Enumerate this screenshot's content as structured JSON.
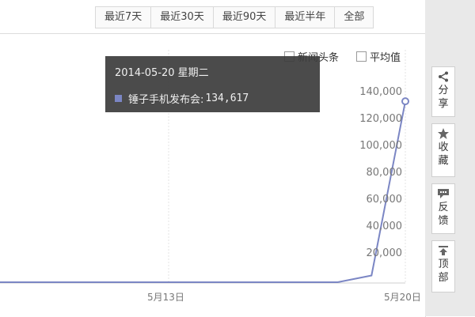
{
  "range_tabs": [
    "最近7天",
    "最近30天",
    "最近90天",
    "最近半年",
    "全部"
  ],
  "legend": [
    {
      "label": "新闻头条",
      "checked": false
    },
    {
      "label": "平均值",
      "checked": false
    }
  ],
  "tooltip": {
    "date": "2014-05-20 星期二",
    "series_label": "锤子手机发布会:",
    "value_text": "134,617",
    "swatch_color": "#7b86c4"
  },
  "side_tools": [
    {
      "icon": "share-icon",
      "label": "分享"
    },
    {
      "icon": "star-icon",
      "label": "收藏"
    },
    {
      "icon": "feedback-icon",
      "label": "反馈"
    },
    {
      "icon": "to-top-icon",
      "label": "顶部"
    }
  ],
  "chart_data": {
    "type": "line",
    "title": "",
    "xlabel": "",
    "ylabel": "",
    "ylim": [
      0,
      140000
    ],
    "y_ticks": [
      "20,000",
      "40,000",
      "60,000",
      "80,000",
      "100,000",
      "120,000",
      "140,000"
    ],
    "x_ticks": [
      "5月13日",
      "5月20日"
    ],
    "series": [
      {
        "name": "锤子手机发布会",
        "color": "#7b86c4",
        "x": [
          "2014-05-05",
          "2014-05-06",
          "2014-05-07",
          "2014-05-08",
          "2014-05-09",
          "2014-05-10",
          "2014-05-11",
          "2014-05-12",
          "2014-05-13",
          "2014-05-14",
          "2014-05-15",
          "2014-05-16",
          "2014-05-17",
          "2014-05-18",
          "2014-05-19",
          "2014-05-20"
        ],
        "values": [
          0,
          0,
          0,
          0,
          0,
          0,
          0,
          0,
          0,
          0,
          0,
          0,
          0,
          0,
          5000,
          134617
        ]
      }
    ]
  }
}
